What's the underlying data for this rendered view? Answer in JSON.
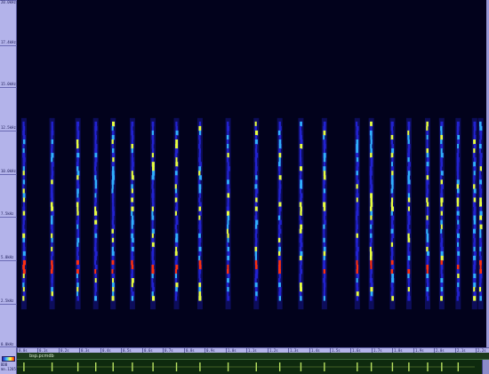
{
  "frequency_axis": {
    "labels": [
      "20.0kHz",
      "17.4kHz",
      "15.0kHz",
      "12.5kHz",
      "10.0kHz",
      "7.5kHz",
      "5.0kHz",
      "2.5kHz",
      "0.0kHz"
    ],
    "tick_positions_khz": [
      20.0,
      17.4,
      15.0,
      12.5,
      10.0,
      7.5,
      5.0,
      2.5,
      0.0
    ]
  },
  "time_axis": {
    "labels": [
      "0.0s",
      "0.1s",
      "0.2s",
      "0.3s",
      "0.4s",
      "0.5s",
      "0.6s",
      "0.7s",
      "0.8s",
      "0.9s",
      "1.0s",
      "1.1s",
      "1.2s",
      "1.3s",
      "1.4s",
      "1.5s",
      "1.6s",
      "1.7s",
      "1.8s",
      "1.9s",
      "2.0s",
      "2.1s",
      "2.2s"
    ]
  },
  "spectrogram": {
    "max_freq_khz": 20.0,
    "calls_time_fraction": [
      0.015,
      0.075,
      0.13,
      0.168,
      0.205,
      0.246,
      0.29,
      0.34,
      0.39,
      0.45,
      0.51,
      0.56,
      0.605,
      0.655,
      0.725,
      0.755,
      0.8,
      0.835,
      0.875,
      0.905,
      0.94,
      0.975,
      0.988
    ],
    "call_top_khz": 13.0,
    "call_bottom_khz": 2.7,
    "colors": {
      "background": "#02021c",
      "low": "#2222d0",
      "mid": "#30b0ff",
      "high": "#e8ff40",
      "peak": "#ff3010"
    }
  },
  "waveform_panel": {
    "title": "bsp.pcmdb",
    "background": "#0e2a0e",
    "trace_color": "#b8e060"
  },
  "readouts": {
    "amp_1": "BDB",
    "amp_2": "mn.1205"
  }
}
